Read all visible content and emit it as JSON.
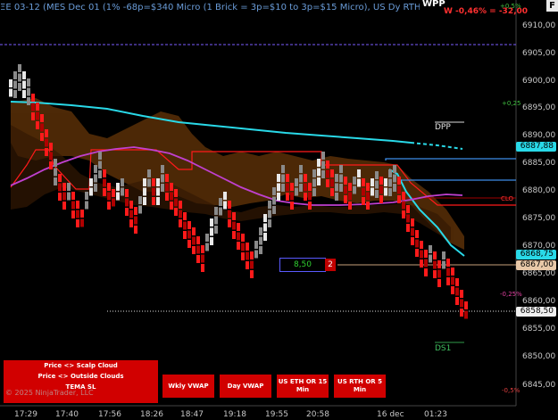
{
  "header": {
    "title": "ΞE 03-12 (MES Dec 01 (1% -68p=$340 Micro (1 Brick = 3p=$10 to 3p=$15 Micro), US Dy RTH, %, TEMA SL",
    "wpp": "WPP",
    "wpct": "W -0,46% = -32,00",
    "top_pct": "+0,5%",
    "f_label": "F"
  },
  "price_axis": [
    "6910,00",
    "6905,00",
    "6900,00",
    "6895,00",
    "6890,00",
    "6885,00",
    "6880,00",
    "6875,00",
    "6870,00",
    "6865,00",
    "6860,00",
    "6855,00",
    "6850,00",
    "6845,00"
  ],
  "price_labels": {
    "cyan_top": "6887,88",
    "cyan_bottom": "6868,75",
    "tan": "6867,00",
    "white": "6858,50"
  },
  "time_axis": [
    "17:29",
    "17:40",
    "17:56",
    "18:26",
    "18:47",
    "19:18",
    "19:55",
    "20:58",
    "16 dec",
    "01:23"
  ],
  "side_labels": {
    "p025": "+0,25",
    "clo": "CLO",
    "m025": "-0,25%",
    "m05": "-0,5%"
  },
  "levels": {
    "dpp": "DPP",
    "ds1": "DS1"
  },
  "order_box": {
    "value": "8,50",
    "count": "2"
  },
  "buttons": {
    "scalp": "Price <> Scalp Cloud",
    "outside": "Price <> Outside Clouds",
    "tema": "TEMA SL",
    "wkly": "Wkly VWAP",
    "day": "Day VWAP",
    "eth": "US ETH OR 15 Min",
    "rth": "US RTH OR 5 Min"
  },
  "copyright": "© 2025 NinjaTrader, LLC",
  "colors": {
    "bull": "#e8e8e8",
    "bull_dim": "#8a8a8a",
    "bear": "#ff1a1a",
    "bear_dark": "#b00000",
    "cyan": "#29d9e8",
    "magenta": "#c040d0",
    "red_line": "#ff1a1a",
    "blue_line": "#3c8ce8",
    "cloud": "#6b3a0a"
  }
}
